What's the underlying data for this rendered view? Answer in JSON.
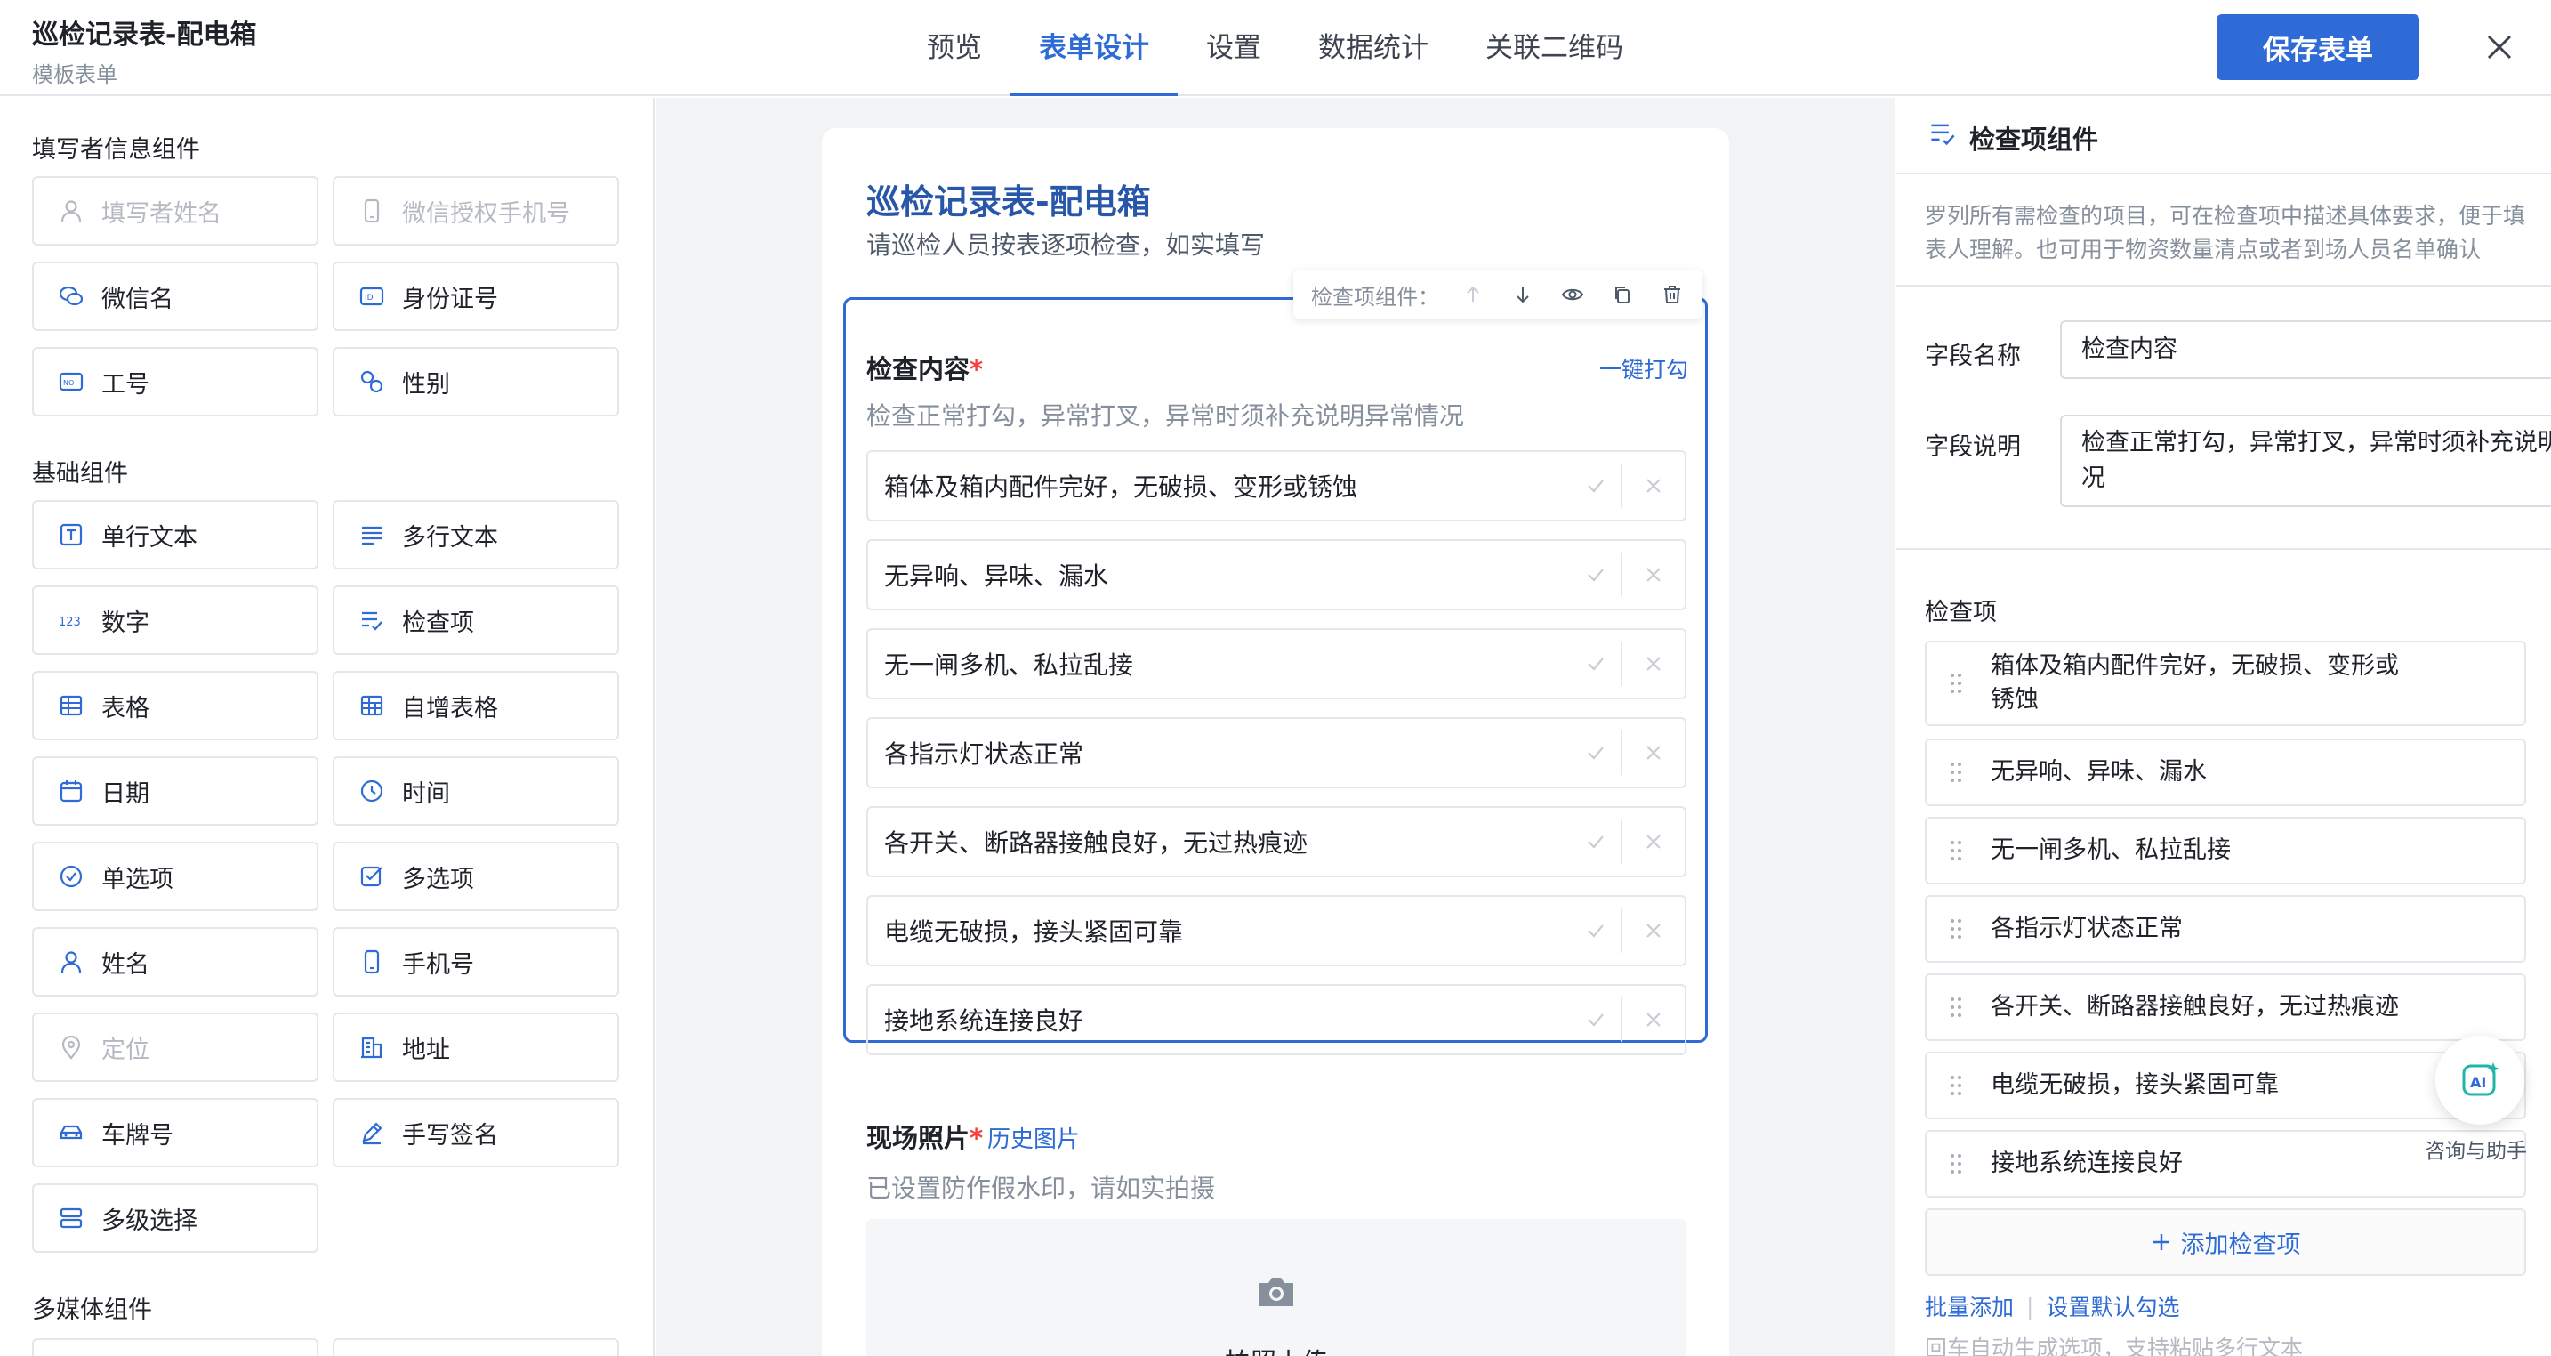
{
  "header": {
    "title": "巡检记录表-配电箱",
    "subtitle": "模板表单",
    "tabs": [
      {
        "label": "预览"
      },
      {
        "label": "表单设计",
        "active": true
      },
      {
        "label": "设置"
      },
      {
        "label": "数据统计"
      },
      {
        "label": "关联二维码"
      }
    ],
    "save_label": "保存表单",
    "accent": "#2e6bd6"
  },
  "left": {
    "groups": [
      {
        "title": "填写者信息组件"
      },
      {
        "title": "基础组件"
      },
      {
        "title": "多媒体组件"
      }
    ],
    "filler": [
      {
        "label": "填写者姓名",
        "icon": "person-icon",
        "disabled": true
      },
      {
        "label": "微信授权手机号",
        "icon": "phone-icon",
        "disabled": true
      },
      {
        "label": "微信名",
        "icon": "wechat-icon"
      },
      {
        "label": "身份证号",
        "icon": "id-card-icon"
      },
      {
        "label": "工号",
        "icon": "badge-icon"
      },
      {
        "label": "性别",
        "icon": "gender-icon"
      }
    ],
    "basic": [
      {
        "label": "单行文本",
        "icon": "text-icon"
      },
      {
        "label": "多行文本",
        "icon": "multiline-text-icon"
      },
      {
        "label": "数字",
        "icon": "number-icon"
      },
      {
        "label": "检查项",
        "icon": "checklist-icon"
      },
      {
        "label": "表格",
        "icon": "table-icon"
      },
      {
        "label": "自增表格",
        "icon": "table-add-icon"
      },
      {
        "label": "日期",
        "icon": "calendar-icon"
      },
      {
        "label": "时间",
        "icon": "clock-icon"
      },
      {
        "label": "单选项",
        "icon": "radio-icon"
      },
      {
        "label": "多选项",
        "icon": "checkbox-icon"
      },
      {
        "label": "姓名",
        "icon": "person-icon"
      },
      {
        "label": "手机号",
        "icon": "phone-icon"
      },
      {
        "label": "定位",
        "icon": "location-icon",
        "disabled": true
      },
      {
        "label": "地址",
        "icon": "building-icon"
      },
      {
        "label": "车牌号",
        "icon": "car-icon"
      },
      {
        "label": "手写签名",
        "icon": "pen-icon"
      },
      {
        "label": "多级选择",
        "icon": "cascade-icon"
      }
    ]
  },
  "form": {
    "title": "巡检记录表-配电箱",
    "description": "请巡检人员按表逐项检查，如实填写",
    "toolbar_label": "检查项组件：",
    "check_field": {
      "label": "检查内容",
      "required_mark": "*",
      "hint": "检查正常打勾，异常打叉，异常时须补充说明异常情况",
      "one_click": "一键打勾",
      "items": [
        "箱体及箱内配件完好，无破损、变形或锈蚀",
        "无异响、异味、漏水",
        "无一闸多机、私拉乱接",
        "各指示灯状态正常",
        "各开关、断路器接触良好，无过热痕迹",
        "电缆无破损，接头紧固可靠",
        "接地系统连接良好"
      ]
    },
    "photo_field": {
      "label": "现场照片",
      "required_mark": "*",
      "history_link": "历史图片",
      "hint": "已设置防作假水印，请如实拍摄",
      "upload_label": "拍照上传"
    }
  },
  "right": {
    "title": "检查项组件",
    "description": "罗列所有需检查的项目，可在检查项中描述具体要求，便于填表人理解。也可用于物资数量清点或者到场人员名单确认",
    "field_name_label": "字段名称",
    "field_name_value": "检查内容",
    "field_desc_label": "字段说明",
    "field_desc_value": "检查正常打勾，异常打叉，异常时须补充说明异常情况",
    "items_label": "检查项",
    "items": [
      "箱体及箱内配件完好，无破损、变形或锈蚀",
      "无异响、异味、漏水",
      "无一闸多机、私拉乱接",
      "各指示灯状态正常",
      "各开关、断路器接触良好，无过热痕迹",
      "电缆无破损，接头紧固可靠",
      "接地系统连接良好"
    ],
    "add_label": "添加检查项",
    "batch_add": "批量添加",
    "set_default": "设置默认勾选",
    "footnote": "回车自动生成选项，支持粘贴多行文本"
  },
  "assistant": {
    "label": "咨询与助手"
  }
}
